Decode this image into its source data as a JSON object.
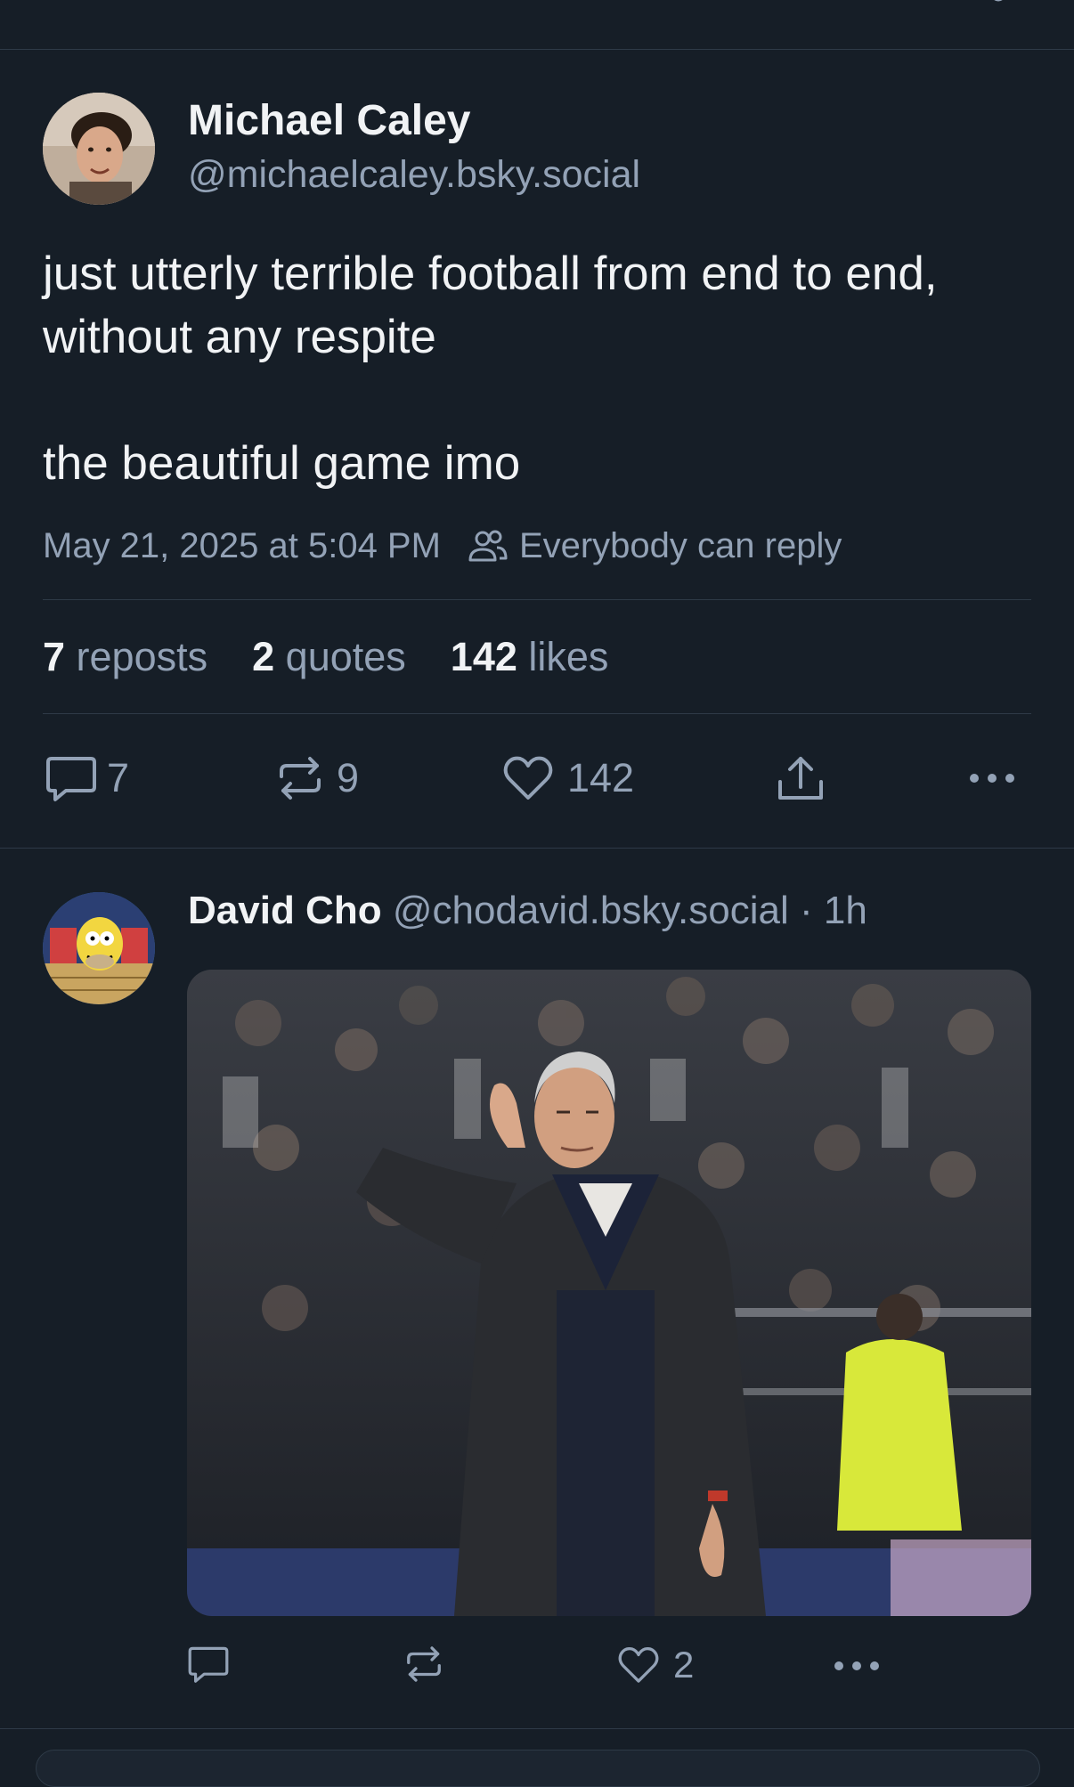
{
  "main_post": {
    "author_name": "Michael Caley",
    "author_handle": "@michaelcaley.bsky.social",
    "text_lines": [
      "just utterly terrible football from end to end, without any respite",
      "the beautiful game imo"
    ],
    "timestamp": "May 21, 2025 at 5:04 PM",
    "reply_setting": "Everybody can reply",
    "stats": {
      "reposts_count": "7",
      "reposts_label": "reposts",
      "quotes_count": "2",
      "quotes_label": "quotes",
      "likes_count": "142",
      "likes_label": "likes"
    },
    "actions": {
      "reply_count": "7",
      "repost_count": "9",
      "like_count": "142"
    },
    "icons": {
      "reply": "chat-bubble-icon",
      "repost": "repost-arrows-icon",
      "like": "heart-icon",
      "share": "share-upload-icon",
      "more": "more-dots-icon",
      "reply_setting": "people-icon"
    }
  },
  "reply_post": {
    "author_name": "David Cho",
    "author_handle": "@chodavid.bsky.social",
    "separator": "·",
    "time_ago": "1h",
    "actions": {
      "like_count": "2"
    }
  },
  "colors": {
    "background": "#161e27",
    "text_primary": "#f1f3f5",
    "text_secondary": "#93a2b6",
    "divider": "#2e3a47"
  }
}
